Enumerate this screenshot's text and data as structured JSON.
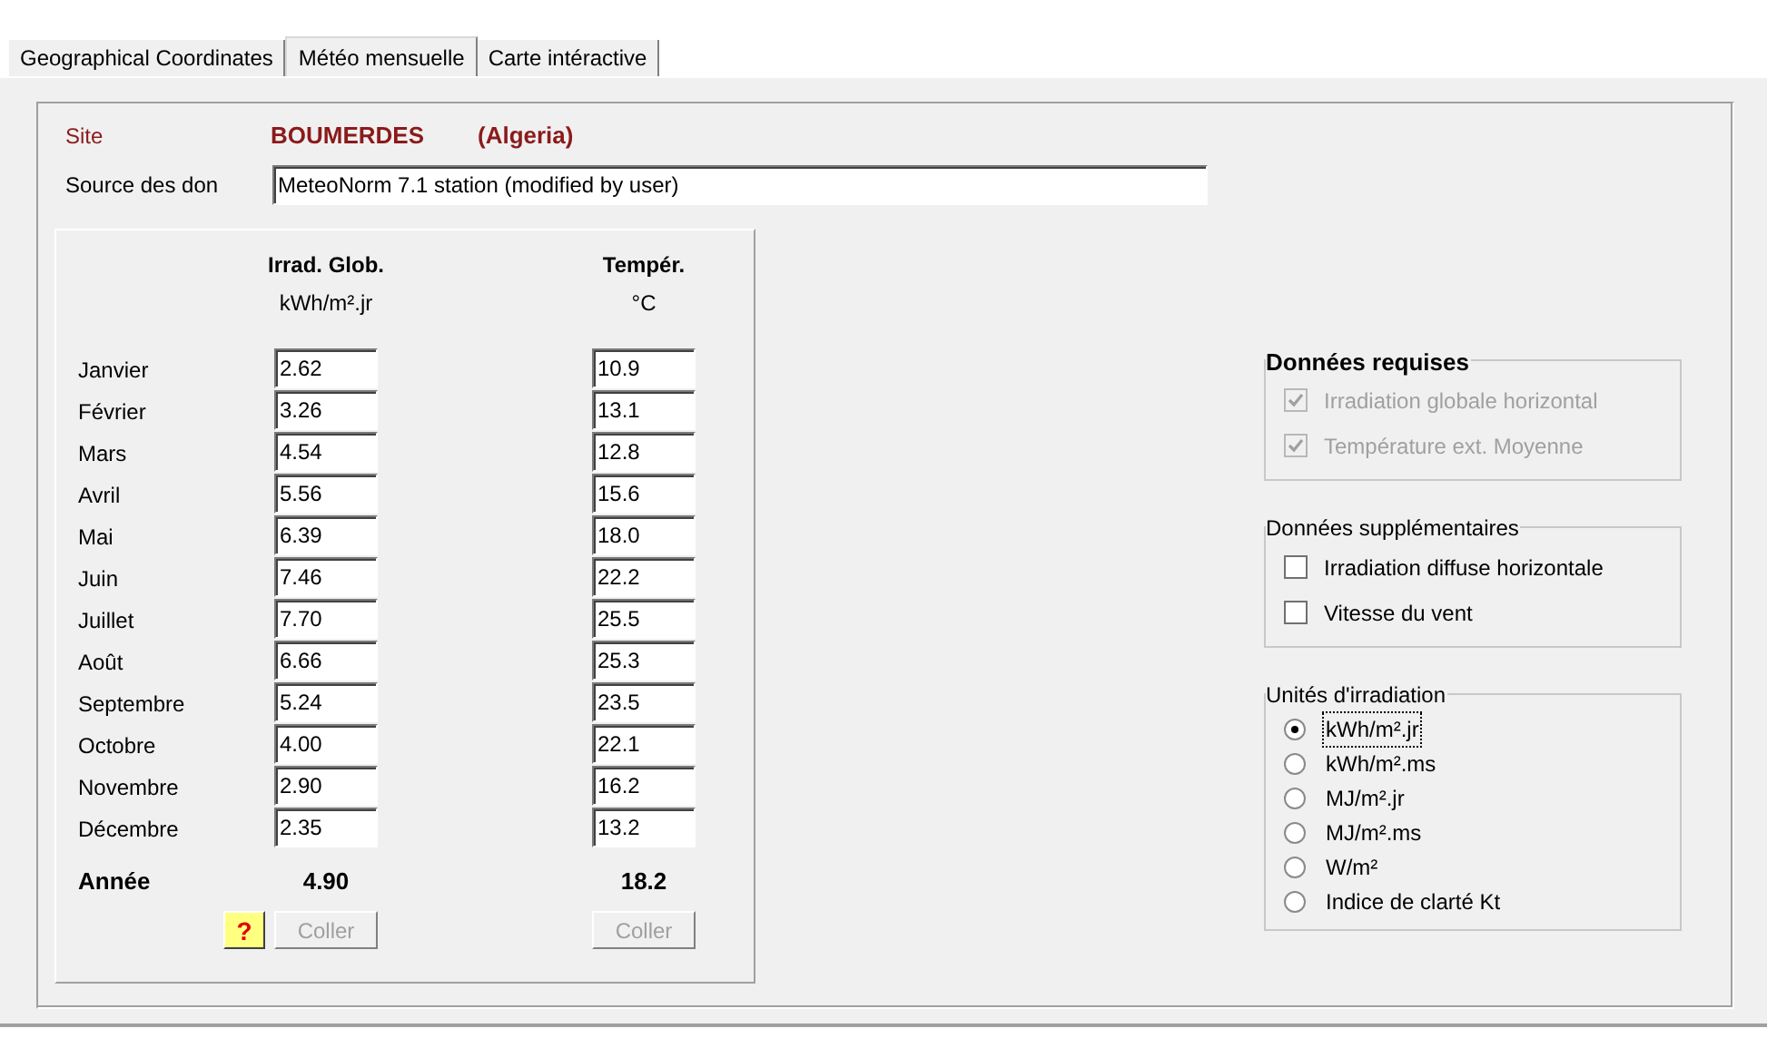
{
  "tabs": [
    {
      "label": "Geographical Coordinates",
      "selected": false
    },
    {
      "label": "Météo mensuelle",
      "selected": true
    },
    {
      "label": "Carte intéractive",
      "selected": false
    }
  ],
  "site": {
    "label": "Site",
    "name": "BOUMERDES",
    "country": "(Algeria)"
  },
  "source": {
    "label": "Source des don",
    "value": "MeteoNorm 7.1 station (modified by user)"
  },
  "table": {
    "columns": [
      {
        "title": "Irrad. Glob.",
        "unit": "kWh/m².jr"
      },
      {
        "title": "Tempér.",
        "unit": "°C"
      }
    ],
    "rows": [
      {
        "month": "Janvier",
        "values": [
          "2.62",
          "10.9"
        ]
      },
      {
        "month": "Février",
        "values": [
          "3.26",
          "13.1"
        ]
      },
      {
        "month": "Mars",
        "values": [
          "4.54",
          "12.8"
        ]
      },
      {
        "month": "Avril",
        "values": [
          "5.56",
          "15.6"
        ]
      },
      {
        "month": "Mai",
        "values": [
          "6.39",
          "18.0"
        ]
      },
      {
        "month": "Juin",
        "values": [
          "7.46",
          "22.2"
        ]
      },
      {
        "month": "Juillet",
        "values": [
          "7.70",
          "25.5"
        ]
      },
      {
        "month": "Août",
        "values": [
          "6.66",
          "25.3"
        ]
      },
      {
        "month": "Septembre",
        "values": [
          "5.24",
          "23.5"
        ]
      },
      {
        "month": "Octobre",
        "values": [
          "4.00",
          "22.1"
        ]
      },
      {
        "month": "Novembre",
        "values": [
          "2.90",
          "16.2"
        ]
      },
      {
        "month": "Décembre",
        "values": [
          "2.35",
          "13.2"
        ]
      }
    ],
    "total": {
      "label": "Année",
      "values": [
        "4.90",
        "18.2"
      ]
    }
  },
  "help_button": {
    "label": "?"
  },
  "paste_buttons": [
    {
      "label": "Coller",
      "disabled": true
    },
    {
      "label": "Coller",
      "disabled": true
    }
  ],
  "groups": [
    {
      "title": "Données requises",
      "bold": true,
      "items": [
        {
          "kind": "checkbox",
          "label": "Irradiation globale horizontal",
          "checked": true,
          "disabled": true
        },
        {
          "kind": "checkbox",
          "label": "Température ext. Moyenne",
          "checked": true,
          "disabled": true
        }
      ]
    },
    {
      "title": "Données supplémentaires",
      "bold": false,
      "items": [
        {
          "kind": "checkbox",
          "label": "Irradiation diffuse horizontale",
          "checked": false,
          "disabled": false
        },
        {
          "kind": "checkbox",
          "label": "Vitesse du vent",
          "checked": false,
          "disabled": false
        }
      ]
    },
    {
      "title": "Unités d'irradiation",
      "bold": false,
      "items": [
        {
          "kind": "radio",
          "label": "kWh/m².jr",
          "selected": true
        },
        {
          "kind": "radio",
          "label": "kWh/m².ms",
          "selected": false
        },
        {
          "kind": "radio",
          "label": "MJ/m².jr",
          "selected": false
        },
        {
          "kind": "radio",
          "label": "MJ/m².ms",
          "selected": false
        },
        {
          "kind": "radio",
          "label": "W/m²",
          "selected": false
        },
        {
          "kind": "radio",
          "label": "Indice de clarté Kt",
          "selected": false
        }
      ]
    }
  ]
}
